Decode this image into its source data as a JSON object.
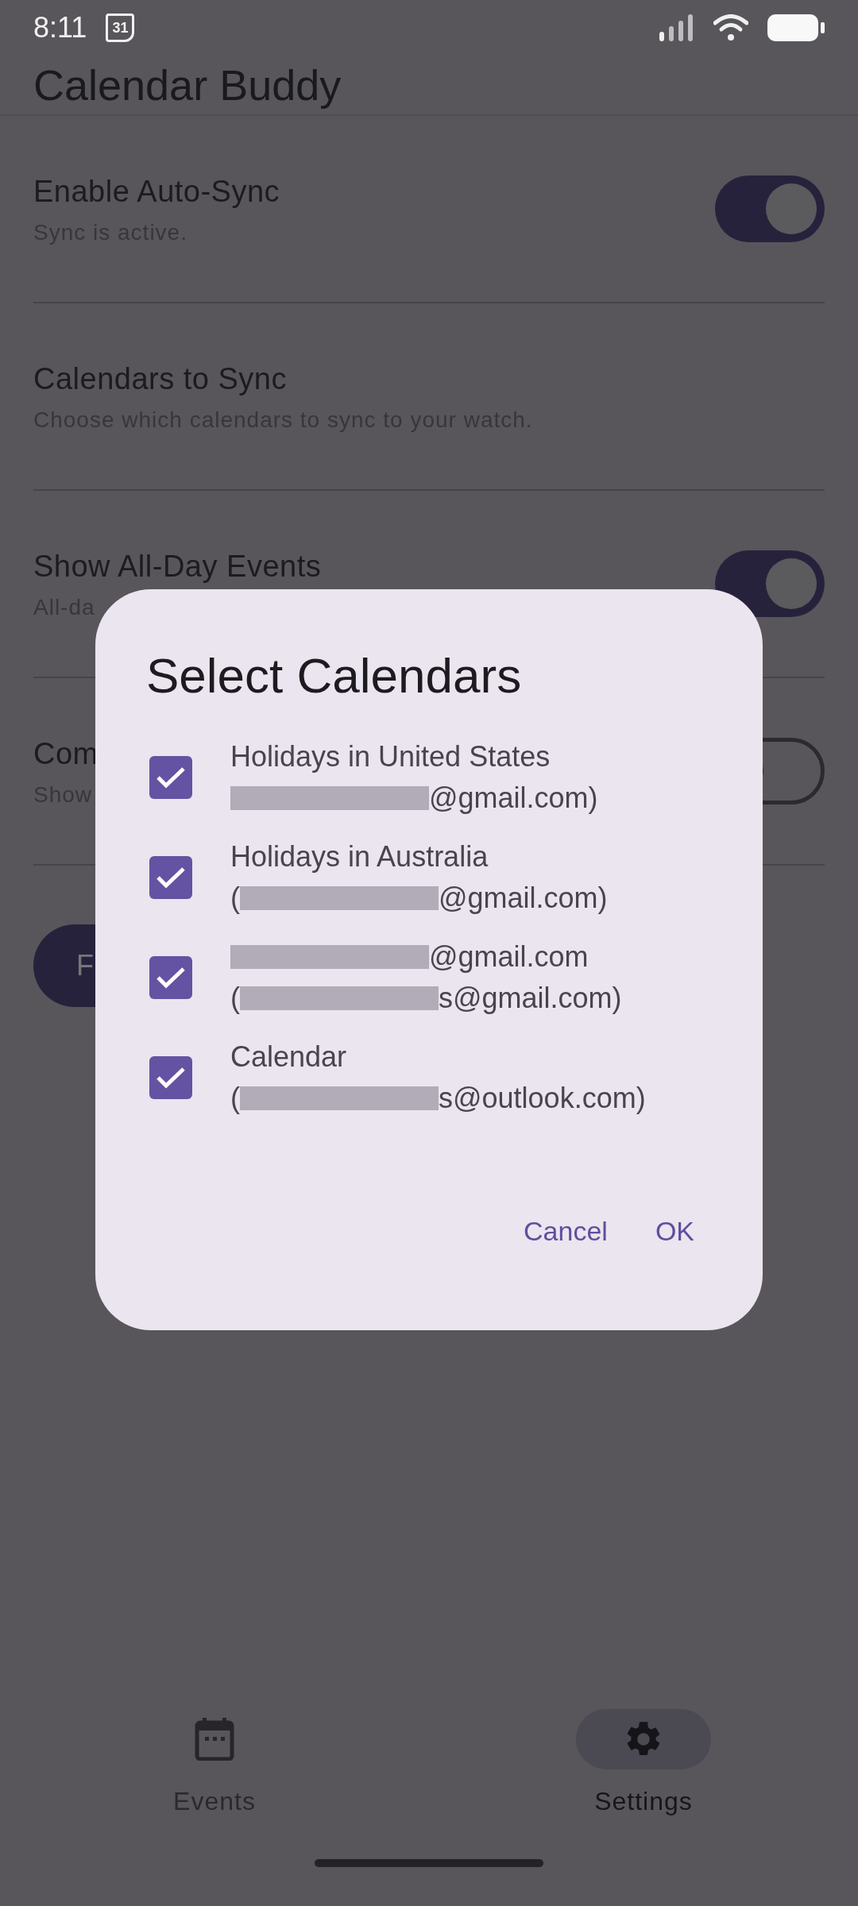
{
  "status_bar": {
    "time": "8:11",
    "notification_date": "31"
  },
  "app_bar": {
    "title": "Calendar Buddy"
  },
  "settings": [
    {
      "kind": "switch",
      "title": "Enable Auto-Sync",
      "subtitle": "Sync is active.",
      "on": true
    },
    {
      "kind": "link",
      "title": "Calendars to Sync",
      "subtitle": "Choose which calendars to sync to your watch."
    },
    {
      "kind": "switch",
      "title": "Show All-Day Events",
      "subtitle": "All-da",
      "on": true
    },
    {
      "kind": "switch",
      "title": "Com",
      "subtitle": "Show",
      "on": false
    }
  ],
  "action_button": {
    "label": "F"
  },
  "dialog": {
    "title": "Select Calendars",
    "calendars": [
      {
        "checked": true,
        "lines": [
          [
            {
              "kind": "text",
              "text": "Holidays in United States"
            }
          ],
          [
            {
              "kind": "redacted"
            },
            {
              "kind": "text",
              "text": "@gmail.com)"
            }
          ]
        ]
      },
      {
        "checked": true,
        "lines": [
          [
            {
              "kind": "text",
              "text": "Holidays in Australia"
            }
          ],
          [
            {
              "kind": "text",
              "text": "("
            },
            {
              "kind": "redacted"
            },
            {
              "kind": "text",
              "text": "@gmail.com)"
            }
          ]
        ]
      },
      {
        "checked": true,
        "lines": [
          [
            {
              "kind": "redacted"
            },
            {
              "kind": "text",
              "text": "@gmail.com"
            }
          ],
          [
            {
              "kind": "text",
              "text": "("
            },
            {
              "kind": "redacted"
            },
            {
              "kind": "text",
              "text": "s@gmail.com)"
            }
          ]
        ]
      },
      {
        "checked": true,
        "lines": [
          [
            {
              "kind": "text",
              "text": "Calendar"
            }
          ],
          [
            {
              "kind": "text",
              "text": "("
            },
            {
              "kind": "redacted"
            },
            {
              "kind": "text",
              "text": "s@outlook.com)"
            }
          ]
        ]
      }
    ],
    "buttons": [
      "Cancel",
      "OK"
    ]
  },
  "bottom_nav": [
    {
      "kind": "events",
      "label": "Events",
      "selected": false
    },
    {
      "kind": "settings",
      "label": "Settings",
      "selected": true
    }
  ]
}
